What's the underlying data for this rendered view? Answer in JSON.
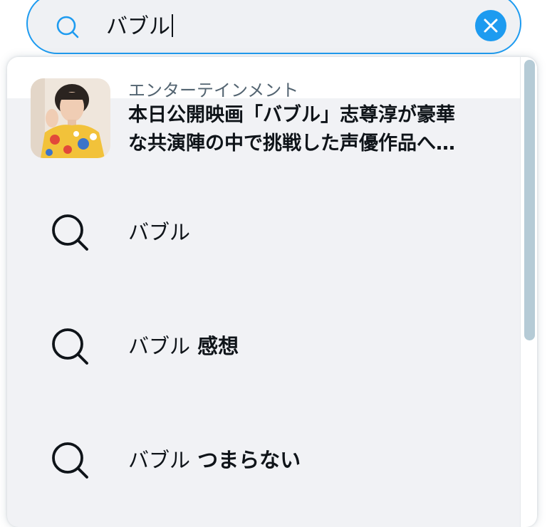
{
  "search": {
    "query": "バブル",
    "icon": "search-icon",
    "clear_icon": "close-icon",
    "accent": "#1d9bf0"
  },
  "trend": {
    "category": "エンターテインメント",
    "title_line1": "本日公開映画「バブル」志尊淳が豪華",
    "title_line2": "な共演陣の中で挑戦した声優作品へ…"
  },
  "suggestions": [
    {
      "base": "バブル",
      "extra": ""
    },
    {
      "base": "バブル",
      "extra": " 感想"
    },
    {
      "base": "バブル",
      "extra": " つまらない"
    }
  ]
}
